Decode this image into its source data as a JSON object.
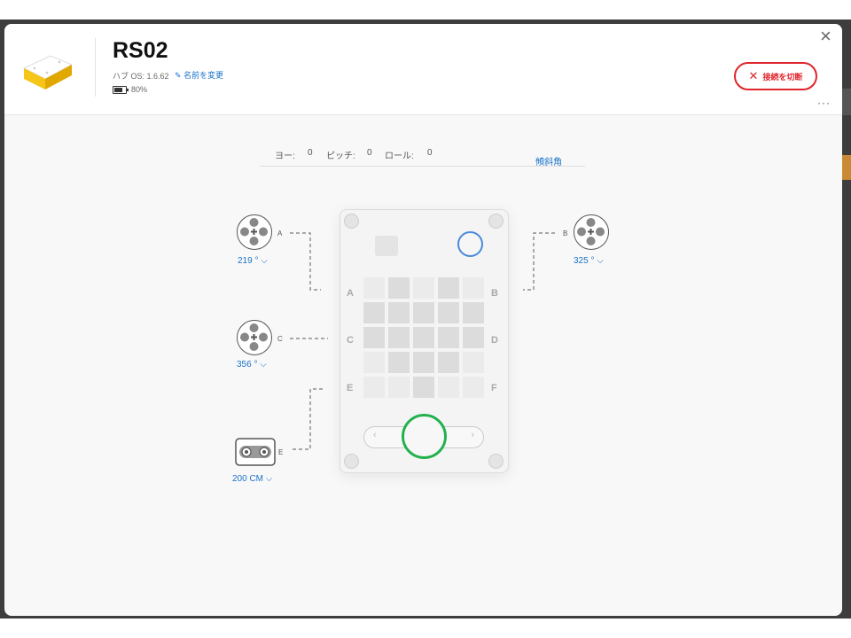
{
  "hub": {
    "name": "RS02",
    "os_version": "ハブ OS: 1.6.62",
    "rename_label": "名前を変更",
    "battery": "80%",
    "disconnect_label": "接続を切断"
  },
  "sensor_bar": {
    "yaw_label": "ヨー:",
    "yaw_value": "0",
    "pitch_label": "ピッチ:",
    "pitch_value": "0",
    "roll_label": "ロール:",
    "roll_value": "0",
    "mode_label": "傾斜角"
  },
  "ports": {
    "A": {
      "letter": "A",
      "type": "motor",
      "value": "219 °"
    },
    "B": {
      "letter": "B",
      "type": "motor",
      "value": "325 °"
    },
    "C": {
      "letter": "C",
      "type": "motor",
      "value": "356 °"
    },
    "E": {
      "letter": "E",
      "type": "distance-sensor",
      "value": "200 CM"
    }
  },
  "hub_ports": [
    "A",
    "B",
    "C",
    "D",
    "E",
    "F"
  ],
  "matrix": {
    "rows": [
      [
        0,
        1,
        0,
        1,
        0
      ],
      [
        1,
        1,
        1,
        1,
        1
      ],
      [
        1,
        1,
        1,
        1,
        1
      ],
      [
        0,
        1,
        1,
        1,
        0
      ],
      [
        0,
        0,
        1,
        0,
        0
      ]
    ]
  },
  "colors": {
    "accent": "#1a73c8",
    "disconnect": "#e0242c",
    "center_button": "#23b14d",
    "bluetooth_button": "#4a8ad8"
  }
}
